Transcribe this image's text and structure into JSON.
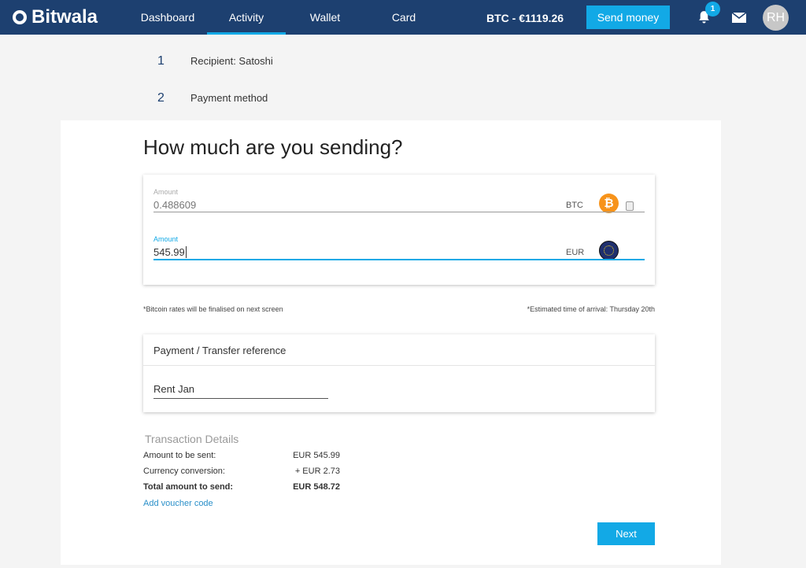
{
  "header": {
    "brand": "Bitwala",
    "nav": [
      "Dashboard",
      "Activity",
      "Wallet",
      "Card"
    ],
    "active_nav": "Activity",
    "rate": "BTC - €1119.26",
    "send_money": "Send money",
    "notifications": "1",
    "avatar_initials": "RH"
  },
  "steps": [
    {
      "number": "1",
      "label": "Recipient: Satoshi"
    },
    {
      "number": "2",
      "label": "Payment method"
    }
  ],
  "title": "How much are you sending?",
  "amount_btc": {
    "label": "Amount",
    "value": "0.488609",
    "currency": "BTC"
  },
  "amount_eur": {
    "label": "Amount",
    "value": "545.99",
    "currency": "EUR"
  },
  "notes": {
    "left": "*Bitcoin rates will be finalised on next screen",
    "right": "*Estimated time of arrival: Thursday 20th"
  },
  "reference": {
    "title": "Payment / Transfer reference",
    "value": "Rent Jan"
  },
  "details": {
    "title": "Transaction Details",
    "rows": [
      {
        "label": "Amount to be sent:",
        "value": "EUR 545.99"
      },
      {
        "label": "Currency conversion:",
        "value": "+ EUR 2.73"
      },
      {
        "label": "Total amount to send:",
        "value": "EUR 548.72"
      }
    ],
    "voucher": "Add voucher code"
  },
  "next": "Next",
  "colors": {
    "header": "#1d4070",
    "accent": "#12a9e6",
    "btc": "#f7931a",
    "eur": "#1f2f6e"
  }
}
